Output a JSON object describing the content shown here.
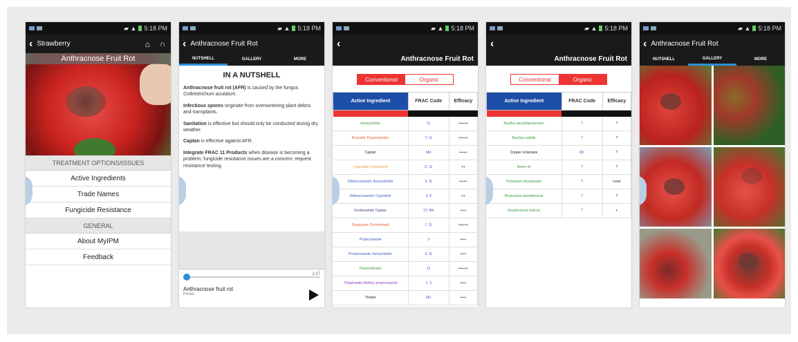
{
  "status": {
    "time": "5:18 PM"
  },
  "phone1": {
    "title": "Strawberry",
    "hero_caption": "Anthracnose Fruit Rot",
    "sections": [
      {
        "header": "TREATMENT OPTIONS/ISSUES",
        "items": [
          "Active Ingredients",
          "Trade Names",
          "Fungicide Resistance"
        ]
      },
      {
        "header": "GENERAL",
        "items": [
          "About MyIPM",
          "Feedback"
        ]
      }
    ]
  },
  "phone2": {
    "title": "Anthracnose Fruit Rot",
    "tabs": [
      "NUTSHELL",
      "GALLERY",
      "MORE"
    ],
    "heading": "IN A NUTSHELL",
    "paragraphs": [
      {
        "bold": "Anthracnose fruit rot (AFR)",
        "text": " is caused by the fungus ",
        "italic": "Colletotrichum acutatum",
        "tail": "."
      },
      {
        "bold": "Infectious spores",
        "text": " originate from overwintering plant debris and transplants.",
        "italic": "",
        "tail": ""
      },
      {
        "bold": "Sanitation",
        "text": " is effective but should only be conducted during dry weather.",
        "italic": "",
        "tail": ""
      },
      {
        "bold": "Captan",
        "text": " is effective against AFR.",
        "italic": "",
        "tail": ""
      },
      {
        "bold": "Integrate FRAC 11 Products",
        "text": " when disease is becoming a problem; fungicide resistance issues are a concern; request resistance testing.",
        "italic": "",
        "tail": ""
      }
    ],
    "player": {
      "time": "2:27",
      "title": "Anthracnose fruit rot",
      "artist": "Peres"
    }
  },
  "phone3": {
    "title": "Anthracnose Fruit Rot",
    "toggle": {
      "left": "Conventional",
      "right": "Organic"
    },
    "headers": [
      "Active Ingredient",
      "FRAC Code",
      "Efficacy"
    ],
    "rows": [
      {
        "name": "Azoxystrobin",
        "color": "#3a9a3a",
        "frac": "11",
        "eff": "+++++"
      },
      {
        "name": "Boscalid; Pyraclostrobin",
        "color": "#e85a3a",
        "frac": "7; 11",
        "eff": "+++++"
      },
      {
        "name": "Captan",
        "color": "#222222",
        "frac": "M4",
        "eff": "++++"
      },
      {
        "name": "Cyprodinil; Fludioxonil",
        "color": "#e89a3a",
        "frac": "9; 12",
        "eff": "++"
      },
      {
        "name": "Difenoconazole; Azoxystrobin",
        "color": "#3a5ac8",
        "frac": "3; 11",
        "eff": "++++"
      },
      {
        "name": "Difenoconazole; Cyprodinil",
        "color": "#3a5ac8",
        "frac": "3; 9",
        "eff": "++"
      },
      {
        "name": "Fenhexamid; Captan",
        "color": "#3a3a8a",
        "frac": "17; M4",
        "eff": "+++"
      },
      {
        "name": "Fluopyram; Pyrimethanil",
        "color": "#e85a3a",
        "frac": "7; 11",
        "eff": "+++++"
      },
      {
        "name": "Propiconazole",
        "color": "#3a5ac8",
        "frac": "3",
        "eff": "+++"
      },
      {
        "name": "Propiconazole; Azoxystrobin",
        "color": "#3a5ac8",
        "frac": "3; 11",
        "eff": "+++"
      },
      {
        "name": "Pyraclostrobin",
        "color": "#3a9a3a",
        "frac": "11",
        "eff": "+++++"
      },
      {
        "name": "Thiophanate Methyl; propiconazole",
        "color": "#8a3ac8",
        "frac": "1; 3",
        "eff": "+++"
      },
      {
        "name": "Thiram",
        "color": "#222222",
        "frac": "M3",
        "eff": "+++"
      }
    ]
  },
  "phone4": {
    "title": "Anthracnose Fruit Rot",
    "toggle": {
      "left": "Conventional",
      "right": "Organic"
    },
    "headers": [
      "Active Ingredient",
      "FRAC Code",
      "Efficacy"
    ],
    "rows": [
      {
        "name": "Bacillus amyloliquefaciens",
        "color": "#3a9a3a",
        "frac": "?",
        "eff": "?"
      },
      {
        "name": "Bacillus subtilis",
        "color": "#3a9a3a",
        "frac": "?",
        "eff": "?"
      },
      {
        "name": "Copper octanoate",
        "color": "#222222",
        "frac": "M1",
        "eff": "?"
      },
      {
        "name": "Neem oil",
        "color": "#3a9a3a",
        "frac": "?",
        "eff": "?"
      },
      {
        "name": "Potassium bicarbonate",
        "color": "#3a9a3a",
        "frac": "?",
        "eff": "none"
      },
      {
        "name": "Reynoutria sachalinensis",
        "color": "#3a9a3a",
        "frac": "?",
        "eff": "?"
      },
      {
        "name": "Streptomyces lydicus",
        "color": "#3a9a3a",
        "frac": "?",
        "eff": "+"
      }
    ]
  },
  "phone5": {
    "title": "Anthracnose Fruit Rot",
    "tabs": [
      "NUTSHELL",
      "GALLERY",
      "MORE"
    ]
  }
}
